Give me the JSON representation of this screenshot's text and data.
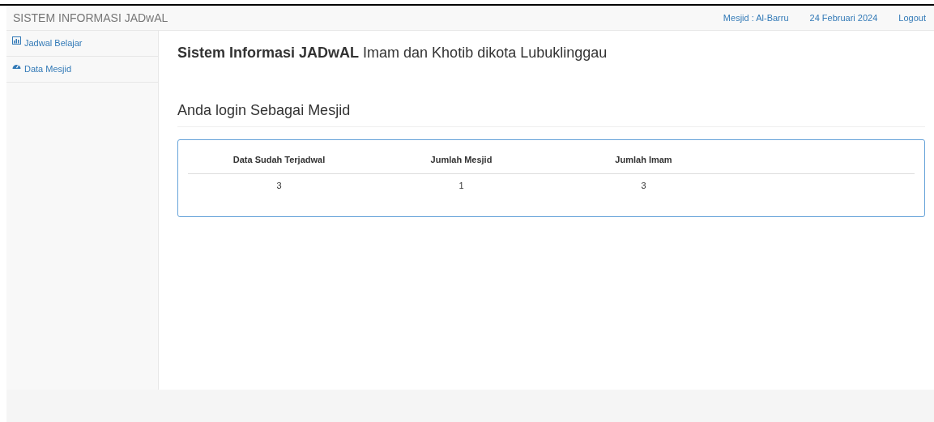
{
  "navbar": {
    "brand": "SISTEM INFORMASI JADwAL",
    "links": [
      "Mesjid : Al-Barru",
      "24 Februari 2024",
      "Logout"
    ]
  },
  "sidebar": {
    "items": [
      {
        "label": "Jadwal Belajar"
      },
      {
        "label": "Data Mesjid"
      }
    ]
  },
  "main": {
    "heading": "**Sistem Informasi JADwAL** Imam dan Khotib dikota Lubuklinggau",
    "subheading": "Anda login Sebagai Mesjid",
    "table": {
      "columns": [
        "Data Sudah Terjadwal",
        "Jumlah Mesjid",
        "Jumlah Imam"
      ],
      "rows": [
        [
          "3",
          "1",
          "3"
        ]
      ]
    }
  }
}
